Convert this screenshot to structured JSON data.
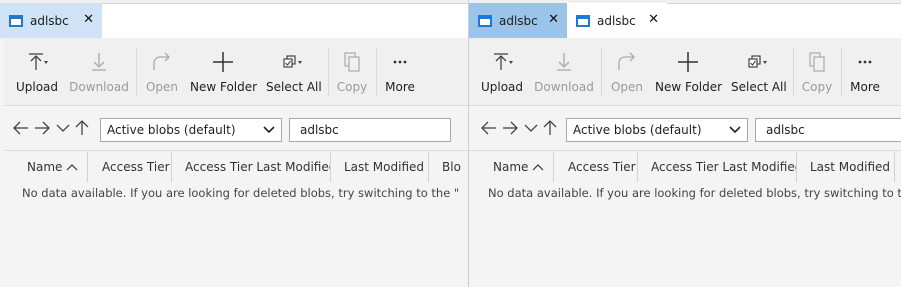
{
  "left": {
    "tabs": [
      {
        "title": "adlsbc",
        "close": "✕"
      }
    ],
    "toolbar": {
      "upload": "Upload",
      "download": "Download",
      "open": "Open",
      "new_folder": "New Folder",
      "select_all": "Select All",
      "copy": "Copy",
      "more": "More"
    },
    "filter": {
      "selected": "Active blobs (default)"
    },
    "path": {
      "value": "adlsbc"
    },
    "columns": [
      "Name",
      "Access Tier",
      "Access Tier Last Modified",
      "Last Modified",
      "Blo"
    ],
    "empty_message": "No data available. If you are looking for deleted blobs, try switching to the \"Deleted"
  },
  "right": {
    "tabs": [
      {
        "title": "adlsbc",
        "close": "✕"
      },
      {
        "title": "adlsbc",
        "close": "✕"
      }
    ],
    "toolbar": {
      "upload": "Upload",
      "download": "Download",
      "open": "Open",
      "new_folder": "New Folder",
      "select_all": "Select All",
      "copy": "Copy",
      "more": "More"
    },
    "filter": {
      "selected": "Active blobs (default)"
    },
    "path": {
      "value": "adlsbc"
    },
    "columns": [
      "Name",
      "Access Tier",
      "Access Tier Last Modified",
      "Last Modified"
    ],
    "empty_message": "No data available. If you are looking for deleted blobs, try switching to the \"De"
  },
  "colors": {
    "accent": "#1e78d4",
    "tab_selected": "#cfe2f6",
    "tab_dimmed": "#9cc3ea"
  }
}
